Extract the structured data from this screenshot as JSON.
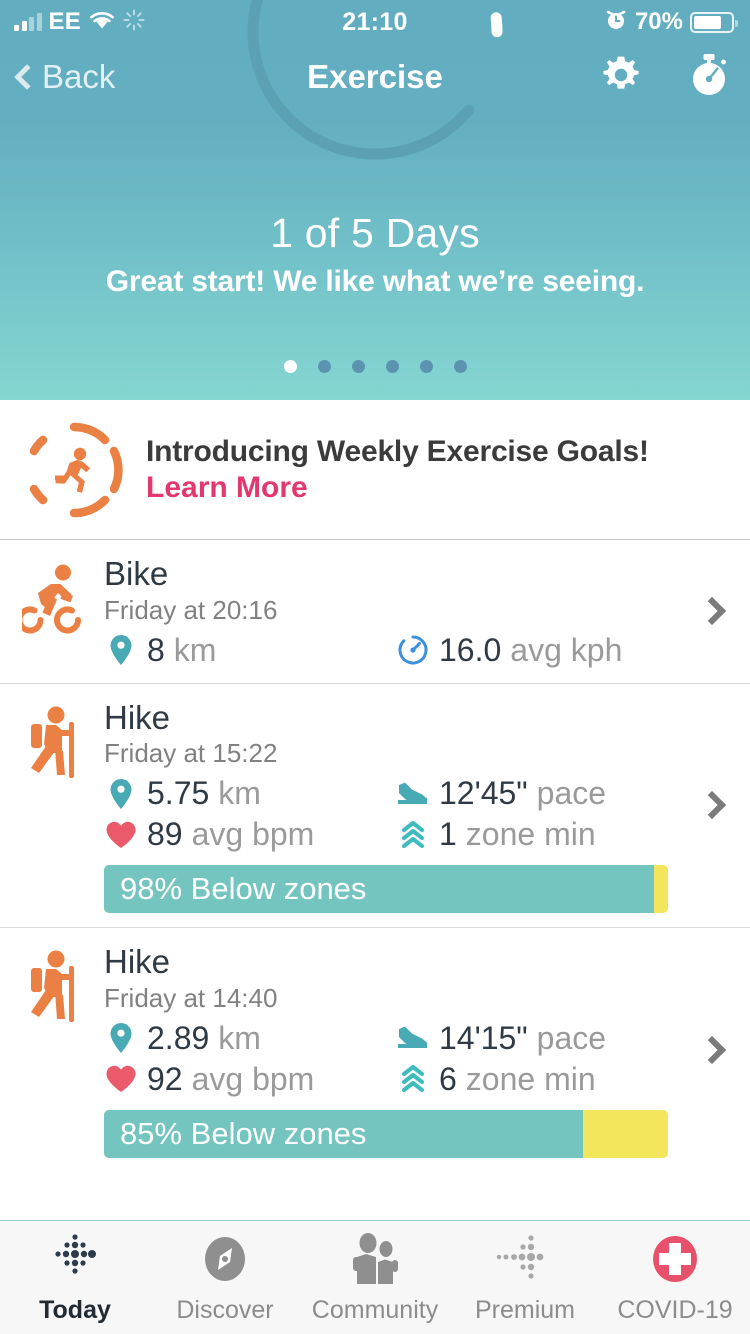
{
  "status_bar": {
    "carrier": "EE",
    "time": "21:10",
    "battery_percent": "70%",
    "signal_icon": "signal-bars-icon",
    "wifi_icon": "wifi-icon",
    "sync_icon": "sync-spinner-icon",
    "alarm_icon": "alarm-clock-icon",
    "battery_icon": "battery-icon"
  },
  "nav": {
    "back_label": "Back",
    "title": "Exercise",
    "settings_icon": "gear-icon",
    "stopwatch_icon": "stopwatch-icon"
  },
  "hero": {
    "progress_label": "1 of 5 Days",
    "encouragement": "Great start! We like what we’re seeing.",
    "progress_value": 1,
    "progress_total": 5,
    "dots_total": 6,
    "dots_active_index": 0,
    "gradient_start": "#62adc0",
    "gradient_end": "#84d6d1"
  },
  "banner": {
    "icon": "running-person-in-ring-icon",
    "title": "Introducing Weekly Exercise Goals!",
    "link_label": "Learn More",
    "link_color": "#e3386d",
    "icon_color": "#ea8043"
  },
  "exercises": [
    {
      "icon": "cyclist-icon",
      "title": "Bike",
      "date": "Friday at 20:16",
      "stats": [
        {
          "icon": "map-pin-icon",
          "value": "8",
          "unit": "km",
          "icon_color": "#48aab4"
        },
        {
          "icon": "speedometer-icon",
          "value": "16.0",
          "unit": "avg kph",
          "icon_color": "#3d8fe0"
        }
      ],
      "zone_bar": null,
      "chevron_icon": "chevron-right-icon"
    },
    {
      "icon": "hiker-icon",
      "title": "Hike",
      "date": "Friday at 15:22",
      "stats": [
        {
          "icon": "map-pin-icon",
          "value": "5.75",
          "unit": "km",
          "icon_color": "#48aab4"
        },
        {
          "icon": "shoe-icon",
          "value": "12'45\"",
          "unit": "pace",
          "icon_color": "#48aab4"
        },
        {
          "icon": "heart-icon",
          "value": "89",
          "unit": "avg bpm",
          "icon_color": "#ea5a6a"
        },
        {
          "icon": "zone-chevrons-icon",
          "value": "1",
          "unit": "zone min",
          "icon_color": "#3fbcc0"
        }
      ],
      "zone_bar": {
        "label": "98% Below zones",
        "percent": 98,
        "fill_color": "#74c4bf",
        "remainder_color": "#f3e55c"
      },
      "chevron_icon": "chevron-right-icon"
    },
    {
      "icon": "hiker-icon",
      "title": "Hike",
      "date": "Friday at 14:40",
      "stats": [
        {
          "icon": "map-pin-icon",
          "value": "2.89",
          "unit": "km",
          "icon_color": "#48aab4"
        },
        {
          "icon": "shoe-icon",
          "value": "14'15\"",
          "unit": "pace",
          "icon_color": "#48aab4"
        },
        {
          "icon": "heart-icon",
          "value": "92",
          "unit": "avg bpm",
          "icon_color": "#ea5a6a"
        },
        {
          "icon": "zone-chevrons-icon",
          "value": "6",
          "unit": "zone min",
          "icon_color": "#3fbcc0"
        }
      ],
      "zone_bar": {
        "label": "85% Below zones",
        "percent": 85,
        "fill_color": "#74c4bf",
        "remainder_color": "#f3e55c"
      },
      "chevron_icon": "chevron-right-icon"
    }
  ],
  "tabs": [
    {
      "label": "Today",
      "icon": "fitbit-dots-today-icon",
      "active": true
    },
    {
      "label": "Discover",
      "icon": "compass-icon",
      "active": false
    },
    {
      "label": "Community",
      "icon": "people-icon",
      "active": false
    },
    {
      "label": "Premium",
      "icon": "fitbit-dots-premium-icon",
      "active": false
    },
    {
      "label": "COVID-19",
      "icon": "medical-cross-icon",
      "active": false
    }
  ]
}
